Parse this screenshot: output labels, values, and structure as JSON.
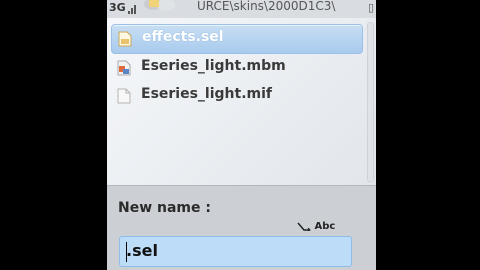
{
  "status": {
    "network": "3G",
    "path": "URCE\\skins\\2000D1C3\\",
    "signal_level": 0.8
  },
  "files": [
    {
      "name": "effects.sel",
      "icon": "sel-file-icon",
      "selected": true
    },
    {
      "name": "Eseries_light.mbm",
      "icon": "mbm-file-icon",
      "selected": false
    },
    {
      "name": "Eseries_light.mif",
      "icon": "mif-file-icon",
      "selected": false
    }
  ],
  "dialog": {
    "title": "New name :",
    "input_mode": "Abc",
    "input_value": ".sel"
  },
  "colors": {
    "selection": "#b5d4f1",
    "input_bg": "#bcdcf7",
    "dialog_bg": "#ccd0d5"
  }
}
